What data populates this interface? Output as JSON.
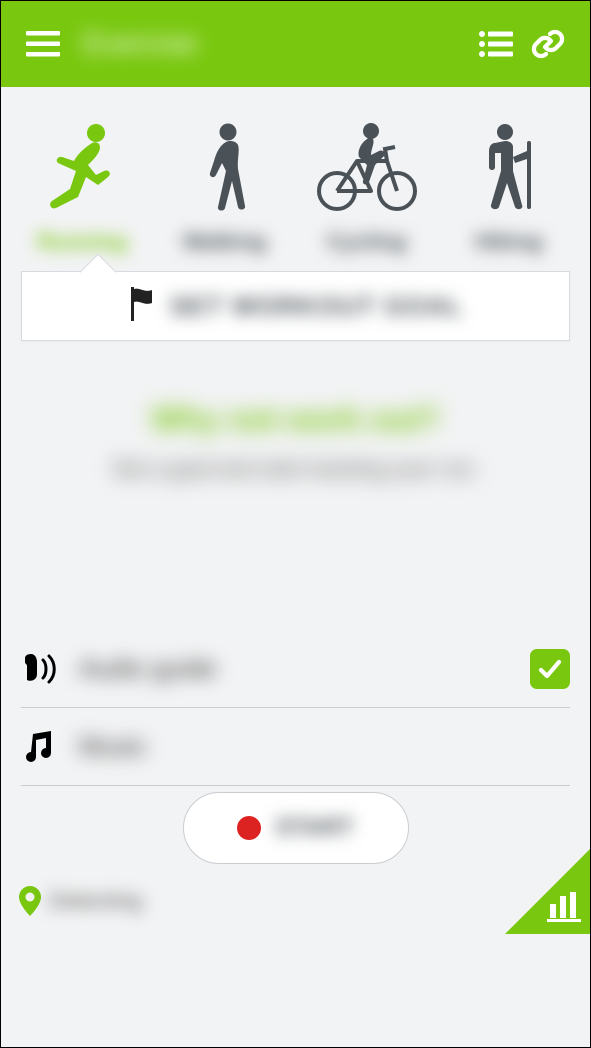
{
  "header": {
    "title": "Exercise"
  },
  "activities": [
    {
      "id": "running",
      "label": "Running",
      "selected": true
    },
    {
      "id": "walking",
      "label": "Walking",
      "selected": false
    },
    {
      "id": "cycling",
      "label": "Cycling",
      "selected": false
    },
    {
      "id": "hiking",
      "label": "Hiking",
      "selected": false
    }
  ],
  "goal": {
    "button_label": "SET WORKOUT GOAL"
  },
  "message": {
    "heading": "Why not work out?",
    "sub": "Set a goal and start tracking your run."
  },
  "options": {
    "audio": {
      "label": "Audio guide",
      "enabled": true
    },
    "music": {
      "label": "Music"
    }
  },
  "footer": {
    "start_label": "START",
    "gps_status": "Detecting"
  },
  "colors": {
    "accent": "#79c70f",
    "record": "#d22"
  }
}
